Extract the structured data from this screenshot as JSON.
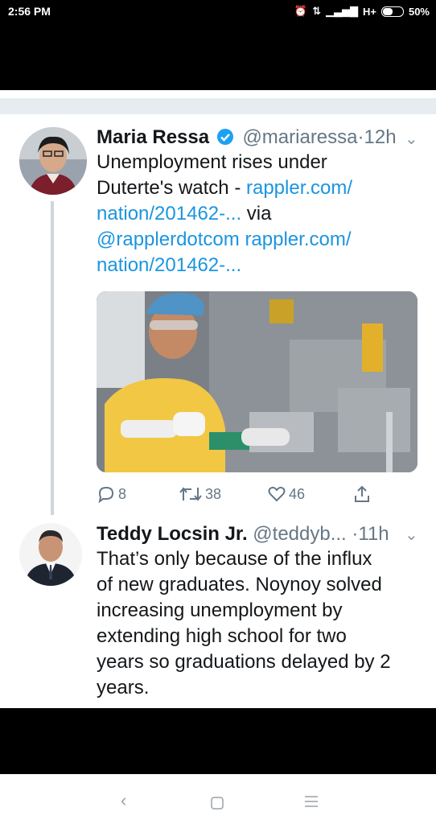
{
  "status": {
    "time": "2:56 PM",
    "signal_text": "H+",
    "battery_percent": "50%"
  },
  "tweet1": {
    "name": "Maria Ressa",
    "handle": "@mariaressa",
    "dot": "·",
    "time": "12h",
    "line1": "Unemployment rises under",
    "line2_text": "Duterte's watch - ",
    "line2_link": "rappler.com/",
    "line3_link": "nation/201462-...",
    "line3_text": " via",
    "line4_link": "@rapplerdotcom rappler.com/",
    "line5_link": "nation/201462-...",
    "replies": "8",
    "retweets": "38",
    "likes": "46"
  },
  "tweet2": {
    "name": "Teddy Locsin Jr.",
    "handle": "@teddyb...",
    "dot": "·",
    "time": "11h",
    "lines": [
      "That’s only because of the influx",
      "of new graduates. Noynoy solved",
      "increasing unemployment by",
      "extending high school for two",
      "years so graduations delayed by 2",
      "years."
    ]
  },
  "icons": {
    "reply": "reply-icon",
    "retweet": "retweet-icon",
    "like": "like-icon",
    "share": "share-icon",
    "verified": "verified-badge-icon",
    "chevron": "chevron-down-icon"
  },
  "colors": {
    "link": "#1b95e0",
    "secondary": "#657786",
    "verified": "#1da1f2",
    "divider": "#e6ecf0"
  }
}
